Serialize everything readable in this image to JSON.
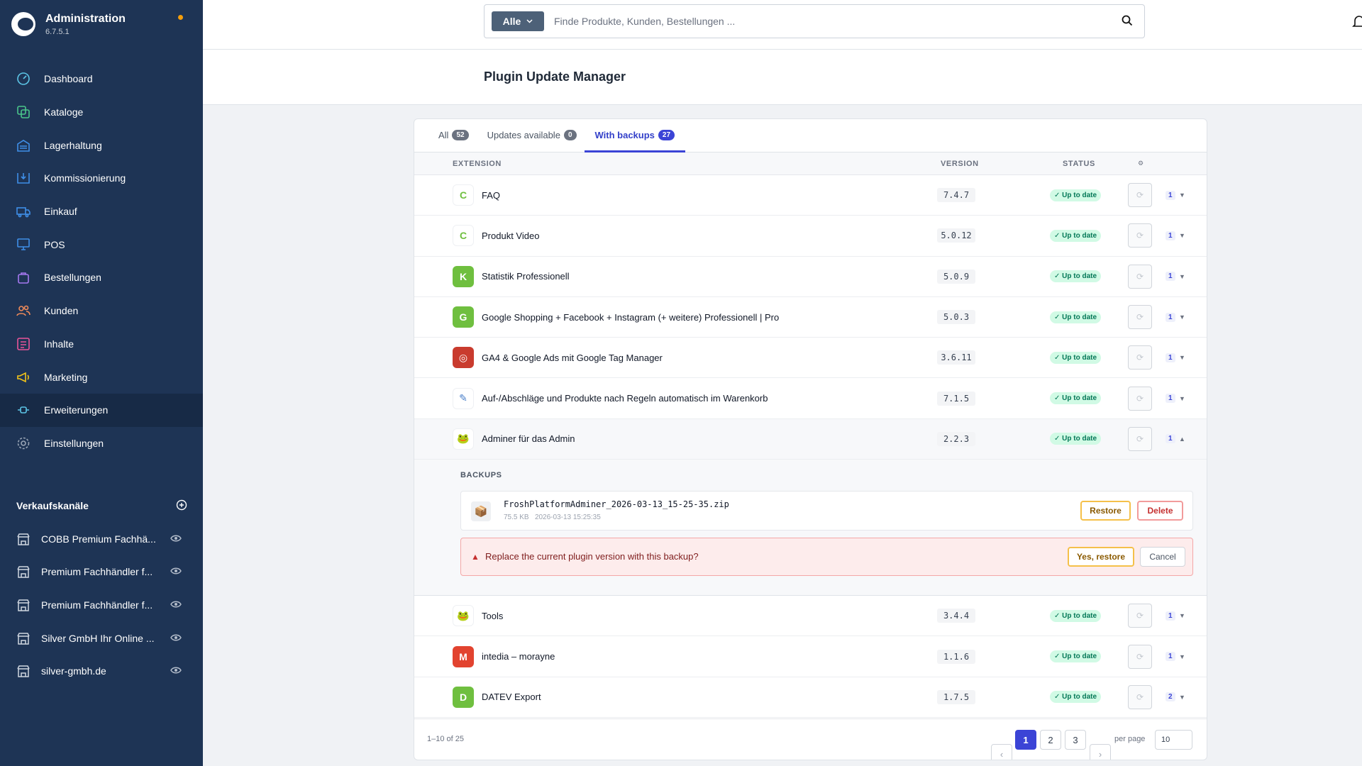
{
  "app": {
    "title": "Administration",
    "version": "6.7.5.1"
  },
  "sidebar": {
    "items": [
      {
        "label": "Dashboard",
        "icon": "dashboard-icon",
        "color": "#5cc5e6"
      },
      {
        "label": "Kataloge",
        "icon": "catalog-icon",
        "color": "#4ac58a"
      },
      {
        "label": "Lagerhaltung",
        "icon": "warehouse-icon",
        "color": "#3f8fe8"
      },
      {
        "label": "Kommissionierung",
        "icon": "picking-icon",
        "color": "#3f8fe8"
      },
      {
        "label": "Einkauf",
        "icon": "truck-icon",
        "color": "#3f8fe8"
      },
      {
        "label": "POS",
        "icon": "pos-icon",
        "color": "#3f8fe8"
      },
      {
        "label": "Bestellungen",
        "icon": "bag-icon",
        "color": "#a578f0"
      },
      {
        "label": "Kunden",
        "icon": "users-icon",
        "color": "#f08b5a"
      },
      {
        "label": "Inhalte",
        "icon": "content-icon",
        "color": "#e9559a"
      },
      {
        "label": "Marketing",
        "icon": "megaphone-icon",
        "color": "#f5c518"
      },
      {
        "label": "Erweiterungen",
        "icon": "plug-icon",
        "color": "#5cc5e6"
      },
      {
        "label": "Einstellungen",
        "icon": "gear-icon",
        "color": "#9aa6b6"
      }
    ],
    "sales_channels_title": "Verkaufskanäle",
    "sales_channels": [
      {
        "label": "COBB Premium Fachhä..."
      },
      {
        "label": "Premium Fachhändler f..."
      },
      {
        "label": "Premium Fachhändler f..."
      },
      {
        "label": "Silver GmbH Ihr Online ..."
      },
      {
        "label": "silver-gmbh.de"
      }
    ]
  },
  "search": {
    "type": "Alle",
    "placeholder": "Finde Produkte, Kunden, Bestellungen ..."
  },
  "page": {
    "title": "Plugin Update Manager"
  },
  "tabs": [
    {
      "label": "All",
      "count": "52"
    },
    {
      "label": "Updates available",
      "count": "0"
    },
    {
      "label": "With backups",
      "count": "27"
    }
  ],
  "table": {
    "headers": {
      "extension": "EXTENSION",
      "version": "VERSION",
      "status": "STATUS",
      "options": "⚙"
    },
    "rows": [
      {
        "name": "FAQ",
        "version": "7.4.7",
        "status": "✓ Up to date",
        "backups": "1",
        "icon_bg": "#ffffff",
        "icon_fg": "#6fbf3f",
        "icon_char": "C"
      },
      {
        "name": "Produkt Video",
        "version": "5.0.12",
        "status": "✓ Up to date",
        "backups": "1",
        "icon_bg": "#ffffff",
        "icon_fg": "#6fbf3f",
        "icon_char": "C"
      },
      {
        "name": "Statistik Professionell",
        "version": "5.0.9",
        "status": "✓ Up to date",
        "backups": "1",
        "icon_bg": "#6fbf3f",
        "icon_fg": "#ffffff",
        "icon_char": "K"
      },
      {
        "name": "Google Shopping + Facebook + Instagram (+ weitere) Professionell | Pro",
        "version": "5.0.3",
        "status": "✓ Up to date",
        "backups": "1",
        "icon_bg": "#6fbf3f",
        "icon_fg": "#ffffff",
        "icon_char": "G"
      },
      {
        "name": "GA4 & Google Ads mit Google Tag Manager",
        "version": "3.6.11",
        "status": "✓ Up to date",
        "backups": "1",
        "icon_bg": "#c93b2e",
        "icon_fg": "#ffffff",
        "icon_char": "◎"
      },
      {
        "name": "Auf-/Abschläge und Produkte nach Regeln automatisch im Warenkorb",
        "version": "7.1.5",
        "status": "✓ Up to date",
        "backups": "1",
        "icon_bg": "#ffffff",
        "icon_fg": "#4a7fc9",
        "icon_char": "✎"
      },
      {
        "name": "Adminer für das Admin",
        "version": "2.2.3",
        "status": "✓ Up to date",
        "backups": "1",
        "icon_bg": "#ffffff",
        "icon_fg": "#2f8fe0",
        "icon_char": "🐸"
      }
    ],
    "rows_after": [
      {
        "name": "Tools",
        "version": "3.4.4",
        "status": "✓ Up to date",
        "backups": "1",
        "icon_bg": "#ffffff",
        "icon_fg": "#2f8fe0",
        "icon_char": "🐸"
      },
      {
        "name": "intedia – morayne",
        "version": "1.1.6",
        "status": "✓ Up to date",
        "backups": "1",
        "icon_bg": "#e2432f",
        "icon_fg": "#ffffff",
        "icon_char": "M"
      },
      {
        "name": "DATEV Export",
        "version": "1.7.5",
        "status": "✓ Up to date",
        "backups": "2",
        "icon_bg": "#6fbf3f",
        "icon_fg": "#ffffff",
        "icon_char": "D"
      }
    ]
  },
  "backups": {
    "label": "BACKUPS",
    "file": "FroshPlatformAdminer_2026-03-13_15-25-35.zip",
    "size": "75.5 KB",
    "date": "2026-03-13 15:25:35",
    "restore": "Restore",
    "delete": "Delete",
    "confirm_question": "Replace the current plugin version with this backup?",
    "yes_restore": "Yes, restore",
    "cancel": "Cancel"
  },
  "pagination": {
    "range": "1–10 of 25",
    "prev": "‹",
    "pages": [
      "1",
      "2",
      "3"
    ],
    "next": "›",
    "per_page_label": "per page",
    "per_page": "10"
  }
}
